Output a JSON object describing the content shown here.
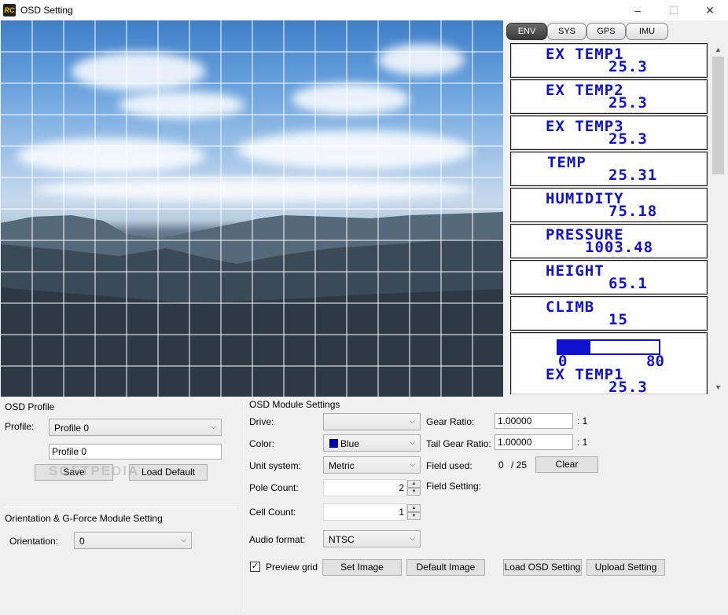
{
  "window": {
    "title": "OSD Setting",
    "icon_text": "RC",
    "minimize": "–",
    "maximize": "☐",
    "close": "✕"
  },
  "osd_tabs": [
    {
      "label": "ENV",
      "active": true
    },
    {
      "label": "SYS",
      "active": false
    },
    {
      "label": "GPS",
      "active": false
    },
    {
      "label": "IMU",
      "active": false
    }
  ],
  "osd_items": [
    {
      "label": "EX TEMP1",
      "value": "25.3"
    },
    {
      "label": "EX TEMP2",
      "value": "25.3"
    },
    {
      "label": "EX TEMP3",
      "value": "25.3"
    },
    {
      "label": "TEMP",
      "value": "25.31"
    },
    {
      "label": "HUMIDITY",
      "value": "75.18"
    },
    {
      "label": "PRESSURE",
      "value": "1003.48"
    },
    {
      "label": "HEIGHT",
      "value": "65.1"
    },
    {
      "label": "CLIMB",
      "value": "15"
    }
  ],
  "osd_bar_item": {
    "min": "0",
    "max": "80",
    "fill_fraction": 0.32,
    "label": "EX TEMP1",
    "value": "25.3"
  },
  "osd_profile": {
    "group_title": "OSD Profile",
    "profile_label": "Profile:",
    "profile_selected": "Profile 0",
    "profile_name": "Profile 0",
    "save_label": "Save",
    "load_default_label": "Load Default"
  },
  "orientation": {
    "group_title": "Orientation & G-Force Module Setting",
    "label": "Orientation:",
    "selected": "0"
  },
  "module_settings": {
    "group_title": "OSD Module Settings",
    "drive_label": "Drive:",
    "drive_value": "",
    "color_label": "Color:",
    "color_value": "Blue",
    "color_hex": "#0000c8",
    "unit_label": "Unit system:",
    "unit_value": "Metric",
    "pole_label": "Pole Count:",
    "pole_value": "2",
    "cell_label": "Cell Count:",
    "cell_value": "1",
    "audio_label": "Audio format:",
    "audio_value": "NTSC",
    "gear_label": "Gear Ratio:",
    "gear_value": "1.00000",
    "gear_suffix": ": 1",
    "tail_gear_label": "Tail Gear Ratio:",
    "tail_gear_value": "1.00000",
    "tail_gear_suffix": ": 1",
    "field_used_label": "Field used:",
    "field_used_value": "0",
    "field_used_total": "/ 25",
    "clear_label": "Clear",
    "field_setting_label": "Field Setting:"
  },
  "bottom_bar": {
    "preview_grid_label": "Preview grid",
    "preview_grid_checked": true,
    "set_image_label": "Set Image",
    "default_image_label": "Default Image",
    "load_osd_label": "Load OSD Setting",
    "upload_label": "Upload Setting"
  },
  "watermark": "SOFTPEDIA"
}
